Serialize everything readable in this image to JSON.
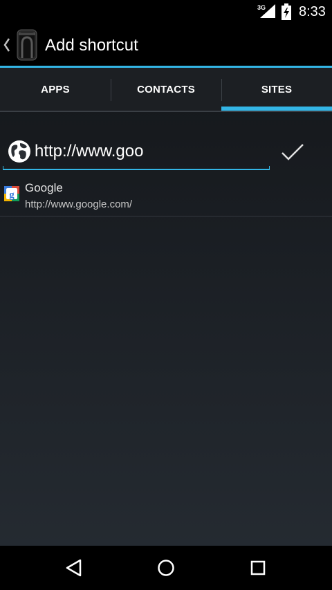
{
  "status_bar": {
    "network_type": "3G",
    "time": "8:33"
  },
  "action_bar": {
    "title": "Add shortcut"
  },
  "tabs": [
    {
      "label": "APPS",
      "selected": false
    },
    {
      "label": "CONTACTS",
      "selected": false
    },
    {
      "label": "SITES",
      "selected": true
    }
  ],
  "url_field": {
    "value": "http://www.goo"
  },
  "suggestions": [
    {
      "title": "Google",
      "url": "http://www.google.com/"
    }
  ],
  "colors": {
    "accent": "#33b5e5",
    "background_top": "#131518",
    "background_bottom": "#262c33",
    "bar": "#000000"
  },
  "icons": {
    "up": "chevron-left-icon",
    "app": "launcher-app-icon",
    "globe": "globe-icon",
    "confirm": "checkmark-icon",
    "favicon": "google-favicon-icon",
    "back": "back-icon",
    "home": "home-icon",
    "recents": "recents-icon"
  }
}
